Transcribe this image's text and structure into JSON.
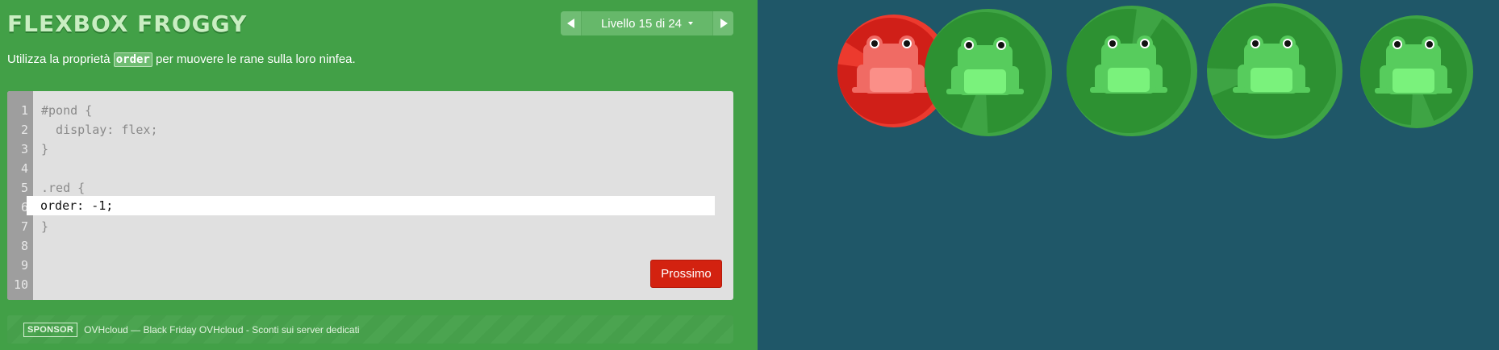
{
  "app": {
    "logo": "FLEXBOX FROGGY"
  },
  "level_nav": {
    "label": "Livello 15 di 24",
    "prev_icon": "triangle-left-icon",
    "next_icon": "triangle-right-icon"
  },
  "instructions": {
    "before": "Utilizza la proprietà ",
    "code": "order",
    "after": " per muovere le rane sulla loro ninfea."
  },
  "editor": {
    "line_numbers": [
      "1",
      "2",
      "3",
      "4",
      "5",
      "6",
      "7",
      "8",
      "9",
      "10"
    ],
    "lines": [
      "#pond {",
      "  display: flex;",
      "}",
      "",
      ".red {",
      "",
      "}",
      "",
      "",
      ""
    ],
    "answer_value": "order: -1;",
    "next_label": "Prossimo"
  },
  "sponsor": {
    "badge": "SPONSOR",
    "text": "OVHcloud — Black Friday OVHcloud - Sconti sui server dedicati"
  },
  "pond": {
    "frogs": [
      "red",
      "green",
      "green",
      "green",
      "green"
    ],
    "colors": {
      "red_pad": "#d01f18",
      "red_pad_rim": "#ec3a2e",
      "green_pad": "#2d9132",
      "green_pad_rim": "#3ea444",
      "red_frog": "#f06b64",
      "red_frog_belly": "#fb8f88",
      "green_frog": "#57cc5d",
      "green_frog_belly": "#7af27c",
      "water": "#1f5768"
    }
  }
}
